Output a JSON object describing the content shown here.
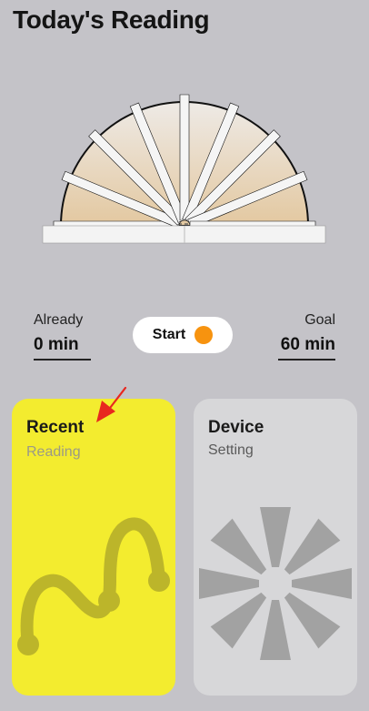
{
  "header": {
    "title": "Today's Reading"
  },
  "stats": {
    "already_label": "Already",
    "already_value": "0 min",
    "goal_label": "Goal",
    "goal_value": "60 min"
  },
  "start_button": {
    "label": "Start",
    "indicator_color": "#f7930f"
  },
  "cards": {
    "recent": {
      "title": "Recent",
      "subtitle": "Reading",
      "background": "#f3ec2f"
    },
    "device": {
      "title": "Device",
      "subtitle": "Setting",
      "background": "#d7d7d9"
    }
  },
  "colors": {
    "page_background": "#c4c3c8",
    "annotation_arrow": "#e8271f"
  }
}
